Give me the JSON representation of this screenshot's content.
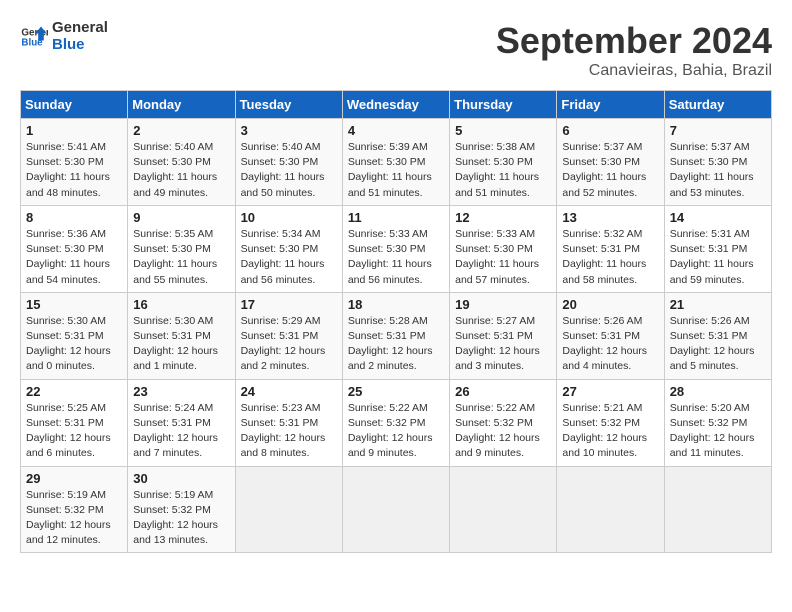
{
  "logo": {
    "line1": "General",
    "line2": "Blue"
  },
  "title": "September 2024",
  "location": "Canavieiras, Bahia, Brazil",
  "weekdays": [
    "Sunday",
    "Monday",
    "Tuesday",
    "Wednesday",
    "Thursday",
    "Friday",
    "Saturday"
  ],
  "weeks": [
    [
      {
        "day": "1",
        "info": "Sunrise: 5:41 AM\nSunset: 5:30 PM\nDaylight: 11 hours\nand 48 minutes."
      },
      {
        "day": "2",
        "info": "Sunrise: 5:40 AM\nSunset: 5:30 PM\nDaylight: 11 hours\nand 49 minutes."
      },
      {
        "day": "3",
        "info": "Sunrise: 5:40 AM\nSunset: 5:30 PM\nDaylight: 11 hours\nand 50 minutes."
      },
      {
        "day": "4",
        "info": "Sunrise: 5:39 AM\nSunset: 5:30 PM\nDaylight: 11 hours\nand 51 minutes."
      },
      {
        "day": "5",
        "info": "Sunrise: 5:38 AM\nSunset: 5:30 PM\nDaylight: 11 hours\nand 51 minutes."
      },
      {
        "day": "6",
        "info": "Sunrise: 5:37 AM\nSunset: 5:30 PM\nDaylight: 11 hours\nand 52 minutes."
      },
      {
        "day": "7",
        "info": "Sunrise: 5:37 AM\nSunset: 5:30 PM\nDaylight: 11 hours\nand 53 minutes."
      }
    ],
    [
      {
        "day": "8",
        "info": "Sunrise: 5:36 AM\nSunset: 5:30 PM\nDaylight: 11 hours\nand 54 minutes."
      },
      {
        "day": "9",
        "info": "Sunrise: 5:35 AM\nSunset: 5:30 PM\nDaylight: 11 hours\nand 55 minutes."
      },
      {
        "day": "10",
        "info": "Sunrise: 5:34 AM\nSunset: 5:30 PM\nDaylight: 11 hours\nand 56 minutes."
      },
      {
        "day": "11",
        "info": "Sunrise: 5:33 AM\nSunset: 5:30 PM\nDaylight: 11 hours\nand 56 minutes."
      },
      {
        "day": "12",
        "info": "Sunrise: 5:33 AM\nSunset: 5:30 PM\nDaylight: 11 hours\nand 57 minutes."
      },
      {
        "day": "13",
        "info": "Sunrise: 5:32 AM\nSunset: 5:31 PM\nDaylight: 11 hours\nand 58 minutes."
      },
      {
        "day": "14",
        "info": "Sunrise: 5:31 AM\nSunset: 5:31 PM\nDaylight: 11 hours\nand 59 minutes."
      }
    ],
    [
      {
        "day": "15",
        "info": "Sunrise: 5:30 AM\nSunset: 5:31 PM\nDaylight: 12 hours\nand 0 minutes."
      },
      {
        "day": "16",
        "info": "Sunrise: 5:30 AM\nSunset: 5:31 PM\nDaylight: 12 hours\nand 1 minute."
      },
      {
        "day": "17",
        "info": "Sunrise: 5:29 AM\nSunset: 5:31 PM\nDaylight: 12 hours\nand 2 minutes."
      },
      {
        "day": "18",
        "info": "Sunrise: 5:28 AM\nSunset: 5:31 PM\nDaylight: 12 hours\nand 2 minutes."
      },
      {
        "day": "19",
        "info": "Sunrise: 5:27 AM\nSunset: 5:31 PM\nDaylight: 12 hours\nand 3 minutes."
      },
      {
        "day": "20",
        "info": "Sunrise: 5:26 AM\nSunset: 5:31 PM\nDaylight: 12 hours\nand 4 minutes."
      },
      {
        "day": "21",
        "info": "Sunrise: 5:26 AM\nSunset: 5:31 PM\nDaylight: 12 hours\nand 5 minutes."
      }
    ],
    [
      {
        "day": "22",
        "info": "Sunrise: 5:25 AM\nSunset: 5:31 PM\nDaylight: 12 hours\nand 6 minutes."
      },
      {
        "day": "23",
        "info": "Sunrise: 5:24 AM\nSunset: 5:31 PM\nDaylight: 12 hours\nand 7 minutes."
      },
      {
        "day": "24",
        "info": "Sunrise: 5:23 AM\nSunset: 5:31 PM\nDaylight: 12 hours\nand 8 minutes."
      },
      {
        "day": "25",
        "info": "Sunrise: 5:22 AM\nSunset: 5:32 PM\nDaylight: 12 hours\nand 9 minutes."
      },
      {
        "day": "26",
        "info": "Sunrise: 5:22 AM\nSunset: 5:32 PM\nDaylight: 12 hours\nand 9 minutes."
      },
      {
        "day": "27",
        "info": "Sunrise: 5:21 AM\nSunset: 5:32 PM\nDaylight: 12 hours\nand 10 minutes."
      },
      {
        "day": "28",
        "info": "Sunrise: 5:20 AM\nSunset: 5:32 PM\nDaylight: 12 hours\nand 11 minutes."
      }
    ],
    [
      {
        "day": "29",
        "info": "Sunrise: 5:19 AM\nSunset: 5:32 PM\nDaylight: 12 hours\nand 12 minutes."
      },
      {
        "day": "30",
        "info": "Sunrise: 5:19 AM\nSunset: 5:32 PM\nDaylight: 12 hours\nand 13 minutes."
      },
      {
        "day": "",
        "info": ""
      },
      {
        "day": "",
        "info": ""
      },
      {
        "day": "",
        "info": ""
      },
      {
        "day": "",
        "info": ""
      },
      {
        "day": "",
        "info": ""
      }
    ]
  ]
}
